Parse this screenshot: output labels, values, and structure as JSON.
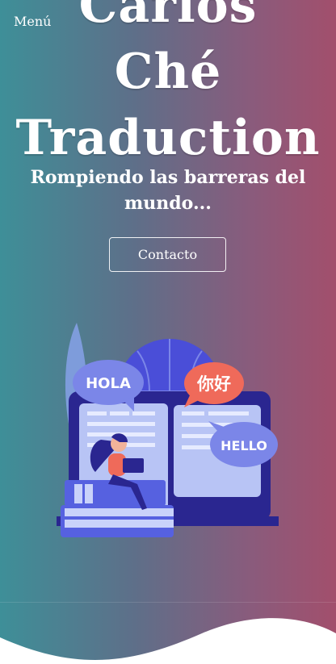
{
  "nav": {
    "menu_label": "Menú"
  },
  "hero": {
    "title_lines": [
      "Carlos",
      "Ché",
      "Traduction"
    ],
    "subtitle": "Rompiendo las barreras del mundo...",
    "cta_label": "Contacto"
  },
  "illustration": {
    "bubbles": [
      "HOLA",
      "你好",
      "HELLO"
    ]
  },
  "colors": {
    "gradient_left": "#3e8f98",
    "gradient_right": "#a24f6c",
    "bubble_blue": "#7b86e8",
    "bubble_red": "#ef6a5a",
    "laptop_dark": "#2a2690"
  },
  "icons": [
    "menu-icon",
    "globe-icon",
    "laptop-icon",
    "speech-bubble-icon",
    "books-icon",
    "leaf-icon"
  ]
}
